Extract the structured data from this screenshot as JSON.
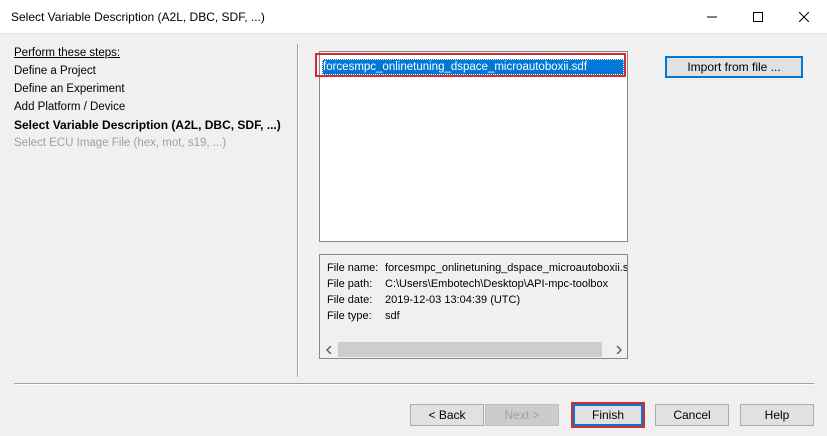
{
  "window": {
    "title": "Select Variable Description (A2L, DBC, SDF, ...)"
  },
  "steps": {
    "header": "Perform these steps:",
    "items": [
      {
        "label": "Define a Project",
        "state": "done"
      },
      {
        "label": "Define an Experiment",
        "state": "done"
      },
      {
        "label": "Add Platform / Device",
        "state": "done"
      },
      {
        "label": "Select Variable Description (A2L, DBC, SDF, ...)",
        "state": "current"
      },
      {
        "label": "Select ECU Image File (hex, mot, s19, ...)",
        "state": "disabled"
      }
    ]
  },
  "file_list": {
    "items": [
      "forcesmpc_onlinetuning_dspace_microautoboxii.sdf"
    ],
    "selected_index": 0
  },
  "import_button": "Import from file ...",
  "file_info": {
    "name_label": "File name:",
    "name_value": "forcesmpc_onlinetuning_dspace_microautoboxii.sdf",
    "path_label": "File path:",
    "path_value": "C:\\Users\\Embotech\\Desktop\\API-mpc-toolbox",
    "date_label": "File date:",
    "date_value": "2019-12-03 13:04:39 (UTC)",
    "type_label": "File type:",
    "type_value": "sdf"
  },
  "buttons": {
    "back": "< Back",
    "next": "Next >",
    "finish": "Finish",
    "cancel": "Cancel",
    "help": "Help"
  },
  "colors": {
    "selection": "#0078d7",
    "highlight_box": "#d62b2b"
  }
}
